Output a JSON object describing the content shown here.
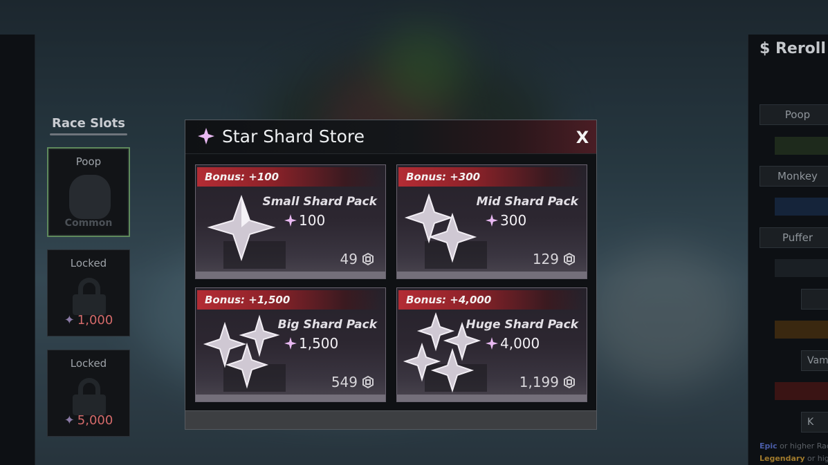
{
  "left_panel": {
    "title": "Race Slots",
    "slots": [
      {
        "name": "Poop",
        "sub": "Common",
        "price": ""
      },
      {
        "name": "Locked",
        "sub": "",
        "price": "1,000"
      },
      {
        "name": "Locked",
        "sub": "",
        "price": "5,000"
      }
    ]
  },
  "right_panel": {
    "title": "$ Reroll C",
    "buttons": [
      "Poop",
      "Monkey",
      "Puffer"
    ],
    "small_buttons": [
      "Vam",
      "K"
    ],
    "note_1": {
      "highlight": "Epic",
      "text": " or higher Race"
    },
    "note_2": {
      "highlight": "Legendary",
      "text": " or highe"
    }
  },
  "modal": {
    "title": "Star Shard Store",
    "close_label": "X",
    "packs": [
      {
        "bonus": "Bonus: +100",
        "name": "Small Shard Pack",
        "amount": "100",
        "price": "49"
      },
      {
        "bonus": "Bonus: +300",
        "name": "Mid Shard Pack",
        "amount": "300",
        "price": "129"
      },
      {
        "bonus": "Bonus: +1,500",
        "name": "Big Shard Pack",
        "amount": "1,500",
        "price": "549"
      },
      {
        "bonus": "Bonus: +4,000",
        "name": "Huge Shard Pack",
        "amount": "4,000",
        "price": "1,199"
      }
    ]
  },
  "colors": {
    "accent_star": "#e9b9f2",
    "bonus_red": "#b32c34",
    "locked_price": "#d46a6a",
    "active_slot_border": "#5f8a5c"
  },
  "icons": {
    "header": "star-shard-icon",
    "currency": "robux-icon",
    "close": "close-icon"
  }
}
